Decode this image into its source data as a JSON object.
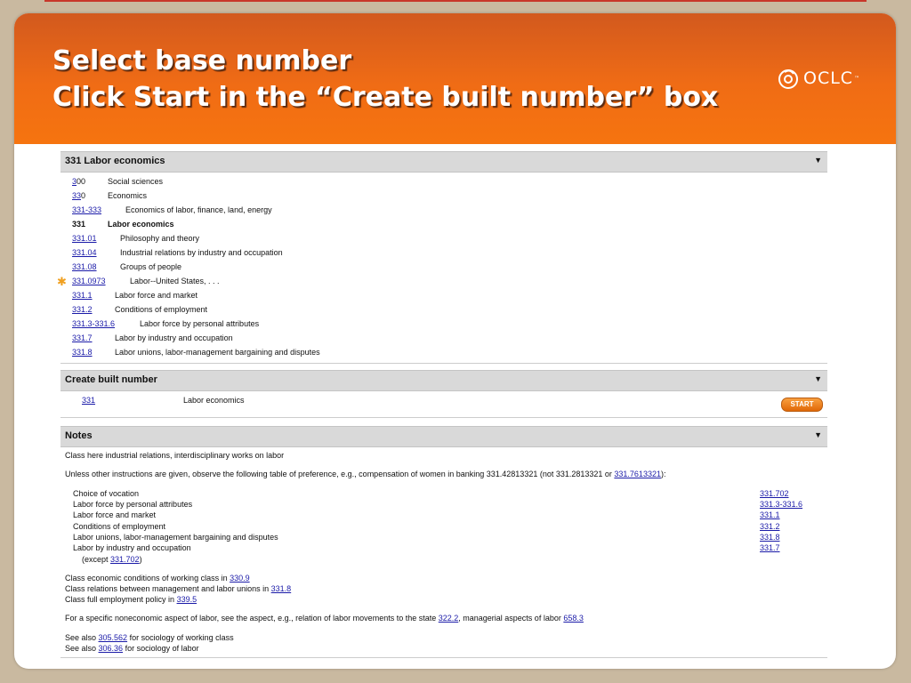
{
  "title": {
    "line1": "Select base number",
    "line2": "Click Start in the “Create built number” box"
  },
  "logo": {
    "text": "OCLC",
    "mark": "™"
  },
  "hierarchy": {
    "header": "331 Labor economics",
    "rows": [
      {
        "num_link": "3",
        "num_rest": "00",
        "label": "Social sciences"
      },
      {
        "num_link": "33",
        "num_rest": "0",
        "label": "Economics"
      },
      {
        "num_link": "331-333",
        "num_rest": "",
        "label": "Economics of labor, finance, land, energy"
      },
      {
        "num_link": "",
        "num_rest": "331",
        "label": "Labor economics"
      },
      {
        "num_link": "331.01",
        "num_rest": "",
        "label": "Philosophy and theory"
      },
      {
        "num_link": "331.04",
        "num_rest": "",
        "label": "Industrial relations by industry and occupation"
      },
      {
        "num_link": "331.08",
        "num_rest": "",
        "label": "Groups of people"
      },
      {
        "num_link": "331.0973",
        "num_rest": "",
        "label": "Labor--United States, . . ."
      },
      {
        "num_link": "331.1",
        "num_rest": "",
        "label": "Labor force and market"
      },
      {
        "num_link": "331.2",
        "num_rest": "",
        "label": "Conditions of employment"
      },
      {
        "num_link": "331.3-331.6",
        "num_rest": "",
        "label": "Labor force by personal attributes"
      },
      {
        "num_link": "331.7",
        "num_rest": "",
        "label": "Labor by industry and occupation"
      },
      {
        "num_link": "331.8",
        "num_rest": "",
        "label": "Labor unions, labor-management bargaining and disputes"
      }
    ]
  },
  "built": {
    "header": "Create built number",
    "number": "331",
    "label": "Labor economics",
    "button": "START"
  },
  "notes": {
    "header": "Notes",
    "line1": "Class here industrial relations, interdisciplinary works on labor",
    "line2_pre": "Unless other instructions are given, observe the following table of preference, e.g., compensation of women in banking 331.42813321 (not 331.2813321 or ",
    "line2_link": "331.7613321",
    "line2_post": "):",
    "preference": [
      {
        "label": "Choice of vocation",
        "num": "331.702"
      },
      {
        "label": "Labor force by personal attributes",
        "num": "331.3-331.6"
      },
      {
        "label": "Labor force and market",
        "num": "331.1"
      },
      {
        "label": "Conditions of employment",
        "num": "331.2"
      },
      {
        "label": "Labor unions, labor-management bargaining and disputes",
        "num": "331.8"
      },
      {
        "label": "Labor by industry and occupation",
        "num": "331.7"
      }
    ],
    "except_pre": "(except ",
    "except_link": "331.702",
    "except_post": ")",
    "class1_pre": "Class economic conditions of working class in ",
    "class1_link": "330.9",
    "class2_pre": "Class relations between management and labor unions in ",
    "class2_link": "331.8",
    "class3_pre": "Class full employment policy in ",
    "class3_link": "339.5",
    "spec_pre": "For a specific noneconomic aspect of labor, see the aspect, e.g., relation of labor movements to the state ",
    "spec_link1": "322.2",
    "spec_mid": ", managerial aspects of labor ",
    "spec_link2": "658.3",
    "see1_pre": "See also ",
    "see1_link": "305.562",
    "see1_post": " for sociology of working class",
    "see2_pre": "See also ",
    "see2_link": "306.36",
    "see2_post": " for sociology of labor"
  },
  "colors": {
    "banner": "#f06c15",
    "link": "#1a1aa8",
    "star": "#f0a020"
  }
}
